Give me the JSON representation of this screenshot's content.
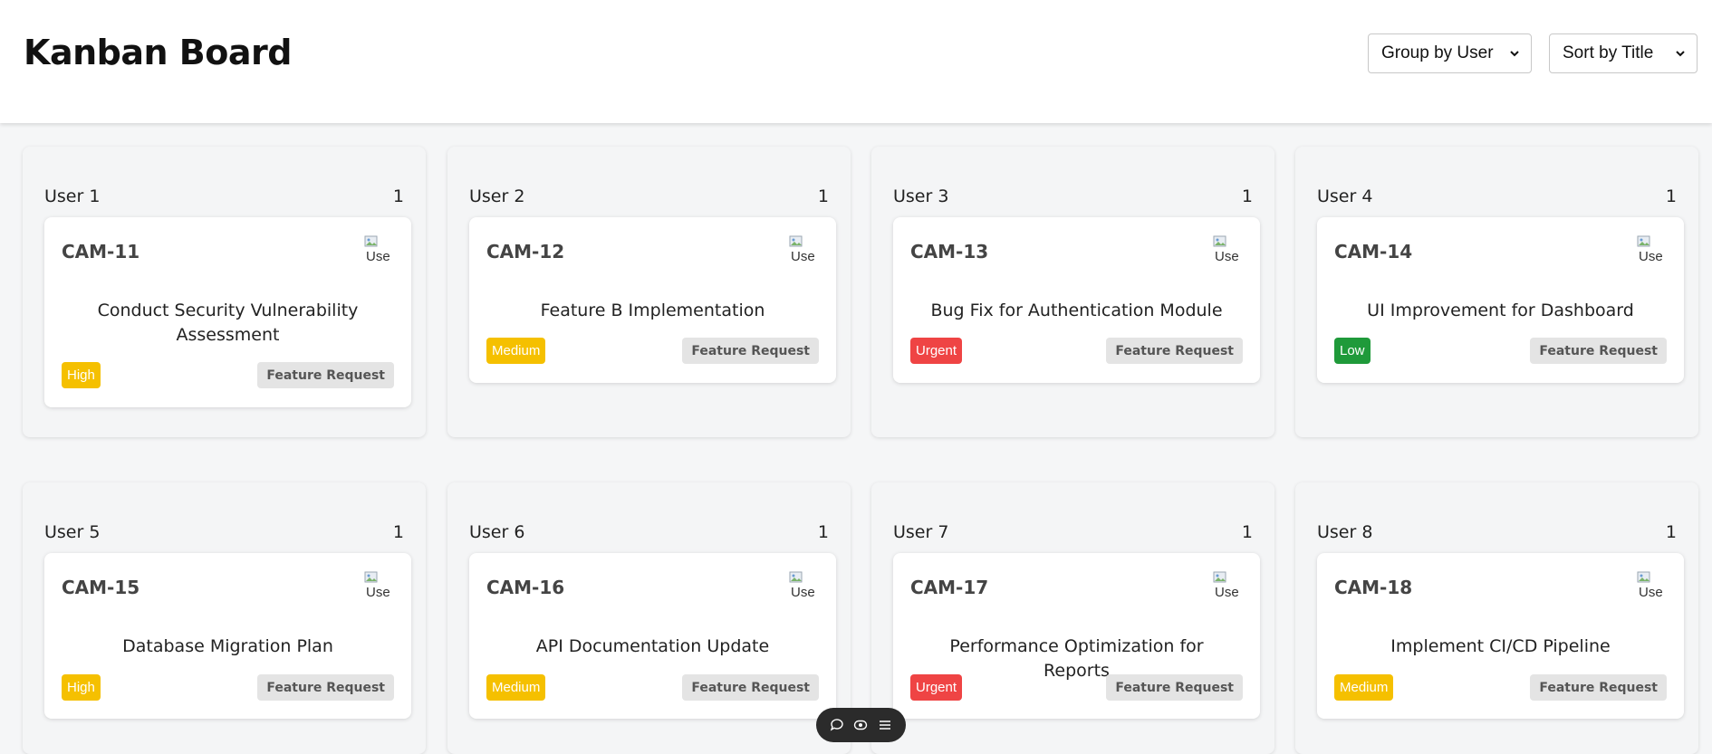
{
  "header": {
    "title": "Kanban Board",
    "group_select": "Group by User",
    "sort_select": "Sort by Title"
  },
  "avatar_alt": "Use",
  "columns": [
    {
      "user": "User 1",
      "count": "1",
      "card": {
        "id": "CAM-11",
        "title": "Conduct Security Vulnerability Assessment",
        "priority": "High",
        "tag": "Feature Request"
      }
    },
    {
      "user": "User 2",
      "count": "1",
      "card": {
        "id": "CAM-12",
        "title": "Feature B Implementation",
        "priority": "Medium",
        "tag": "Feature Request"
      }
    },
    {
      "user": "User 3",
      "count": "1",
      "card": {
        "id": "CAM-13",
        "title": "Bug Fix for Authentication Module",
        "priority": "Urgent",
        "tag": "Feature Request"
      }
    },
    {
      "user": "User 4",
      "count": "1",
      "card": {
        "id": "CAM-14",
        "title": "UI Improvement for Dashboard",
        "priority": "Low",
        "tag": "Feature Request"
      }
    },
    {
      "user": "User 5",
      "count": "1",
      "card": {
        "id": "CAM-15",
        "title": "Database Migration Plan",
        "priority": "High",
        "tag": "Feature Request"
      }
    },
    {
      "user": "User 6",
      "count": "1",
      "card": {
        "id": "CAM-16",
        "title": "API Documentation Update",
        "priority": "Medium",
        "tag": "Feature Request"
      }
    },
    {
      "user": "User 7",
      "count": "1",
      "card": {
        "id": "CAM-17",
        "title": "Performance Optimization for Reports",
        "priority": "Urgent",
        "tag": "Feature Request"
      }
    },
    {
      "user": "User 8",
      "count": "1",
      "card": {
        "id": "CAM-18",
        "title": "Implement CI/CD Pipeline",
        "priority": "Medium",
        "tag": "Feature Request"
      }
    }
  ],
  "priority_colors": {
    "High": "#f5c000",
    "Medium": "#f5c000",
    "Urgent": "#ef4444",
    "Low": "#1f9a3a"
  },
  "floating_toolbar": {
    "icons": [
      "comment-icon",
      "eye-icon",
      "menu-icon"
    ]
  }
}
